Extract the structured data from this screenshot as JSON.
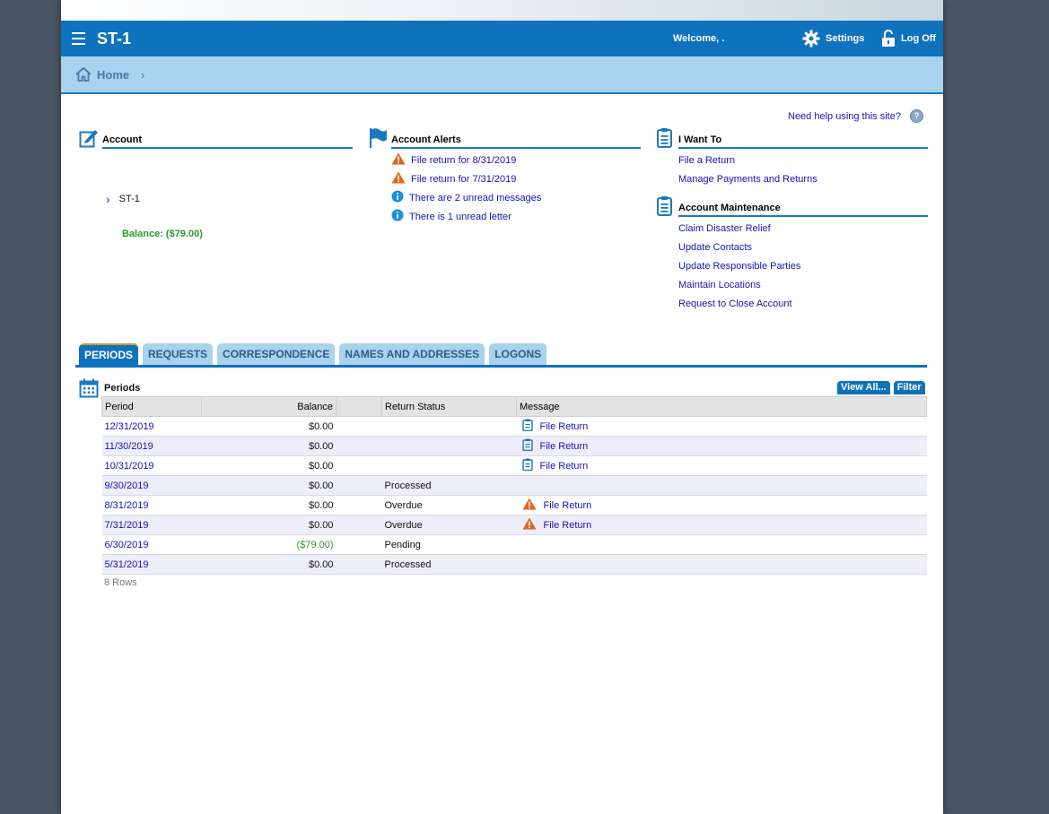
{
  "app": {
    "title": "ST-1",
    "welcome": "Welcome, .",
    "settings_label": "Settings",
    "logoff_label": "Log Off"
  },
  "breadcrumb": {
    "home": "Home"
  },
  "help": {
    "text": "Need help using this site?"
  },
  "account": {
    "heading": "Account",
    "id": "ST-1",
    "balance": "Balance: ($79.00)"
  },
  "alerts": {
    "heading": "Account Alerts",
    "items": [
      {
        "icon": "warning-icon",
        "text": "File return for 8/31/2019"
      },
      {
        "icon": "warning-icon",
        "text": "File return for 7/31/2019"
      },
      {
        "icon": "info-icon",
        "text": "There are 2 unread messages"
      },
      {
        "icon": "info-icon",
        "text": "There is 1 unread letter"
      }
    ]
  },
  "iwantto": {
    "heading": "I Want To",
    "items": [
      "File a Return",
      "Manage Payments and Returns"
    ]
  },
  "maintenance": {
    "heading": "Account Maintenance",
    "items": [
      "Claim Disaster Relief",
      "Update Contacts",
      "Update Responsible Parties",
      "Maintain Locations",
      "Request to Close Account"
    ]
  },
  "tabs": [
    "PERIODS",
    "REQUESTS",
    "CORRESPONDENCE",
    "NAMES AND ADDRESSES",
    "LOGONS"
  ],
  "grid": {
    "title": "Periods",
    "view_all": "View All...",
    "filter": "Filter",
    "columns": [
      "Period",
      "Balance",
      "",
      "Return Status",
      "Message"
    ],
    "rows": [
      {
        "period": "12/31/2019",
        "balance": "$0.00",
        "status": "",
        "message": "File Return",
        "msg_icon": "clipboard-icon"
      },
      {
        "period": "11/30/2019",
        "balance": "$0.00",
        "status": "",
        "message": "File Return",
        "msg_icon": "clipboard-icon"
      },
      {
        "period": "10/31/2019",
        "balance": "$0.00",
        "status": "",
        "message": "File Return",
        "msg_icon": "clipboard-icon"
      },
      {
        "period": "9/30/2019",
        "balance": "$0.00",
        "status": "Processed",
        "message": "",
        "msg_icon": ""
      },
      {
        "period": "8/31/2019",
        "balance": "$0.00",
        "status": "Overdue",
        "message": "File Return",
        "msg_icon": "warning-icon"
      },
      {
        "period": "7/31/2019",
        "balance": "$0.00",
        "status": "Overdue",
        "message": "File Return",
        "msg_icon": "warning-icon"
      },
      {
        "period": "6/30/2019",
        "balance": "($79.00)",
        "status": "Pending",
        "message": "",
        "msg_icon": ""
      },
      {
        "period": "5/31/2019",
        "balance": "$0.00",
        "status": "Processed",
        "message": "",
        "msg_icon": ""
      }
    ],
    "row_count": "8 Rows"
  },
  "colors": {
    "primary": "#0f72bd",
    "breadcrumb": "#a9d2ef",
    "link": "#1414b8",
    "warning": "#e0661b",
    "info": "#1a8fe0",
    "balance_negative": "#2a9a2a"
  }
}
